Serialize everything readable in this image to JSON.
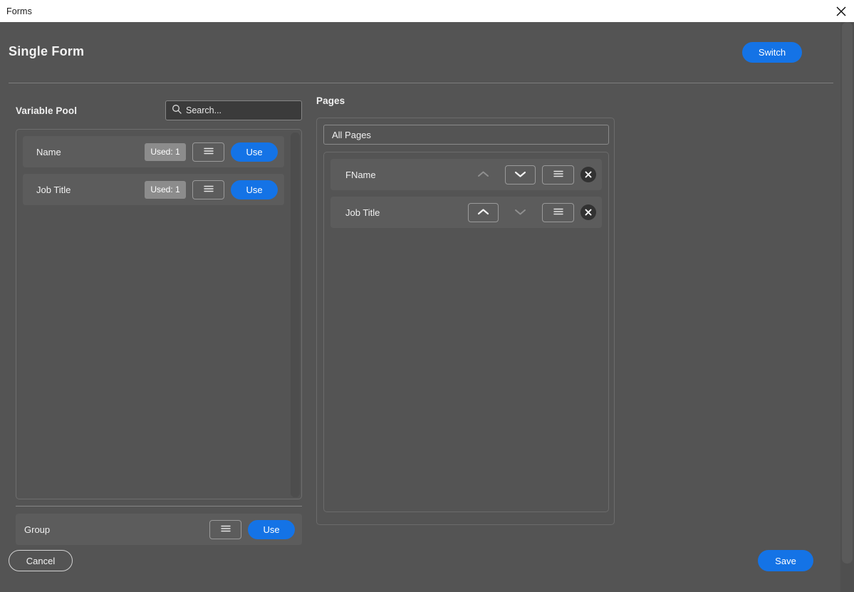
{
  "window": {
    "title": "Forms",
    "close_icon": "close-icon"
  },
  "header": {
    "title": "Single Form",
    "switch_label": "Switch"
  },
  "variable_pool": {
    "label": "Variable Pool",
    "search": {
      "placeholder": "Search...",
      "value": "",
      "icon": "search-icon"
    },
    "rows": [
      {
        "label": "Name",
        "used_badge": "Used: 1",
        "menu_icon": "hamburger-icon",
        "use_label": "Use"
      },
      {
        "label": "Job Title",
        "used_badge": "Used: 1",
        "menu_icon": "hamburger-icon",
        "use_label": "Use"
      }
    ],
    "group": {
      "label": "Group",
      "menu_icon": "hamburger-icon",
      "use_label": "Use"
    }
  },
  "pages": {
    "label": "Pages",
    "filter_value": "All Pages",
    "rows": [
      {
        "label": "FName",
        "move_up_icon": "chevron-up-icon",
        "move_up_enabled": false,
        "move_down_icon": "chevron-down-icon",
        "move_down_enabled": true,
        "menu_icon": "hamburger-icon",
        "remove_icon": "close-circle-icon"
      },
      {
        "label": "Job Title",
        "move_up_icon": "chevron-up-icon",
        "move_up_enabled": true,
        "move_down_icon": "chevron-down-icon",
        "move_down_enabled": false,
        "menu_icon": "hamburger-icon",
        "remove_icon": "close-circle-icon"
      }
    ]
  },
  "footer": {
    "cancel_label": "Cancel",
    "save_label": "Save"
  },
  "colors": {
    "accent": "#1473e6",
    "app_background": "#545454",
    "row_background": "#5c5c5c",
    "badge_background": "#8c8c8c",
    "titlebar_background": "#ffffff",
    "text_primary": "#f0f0f0"
  }
}
